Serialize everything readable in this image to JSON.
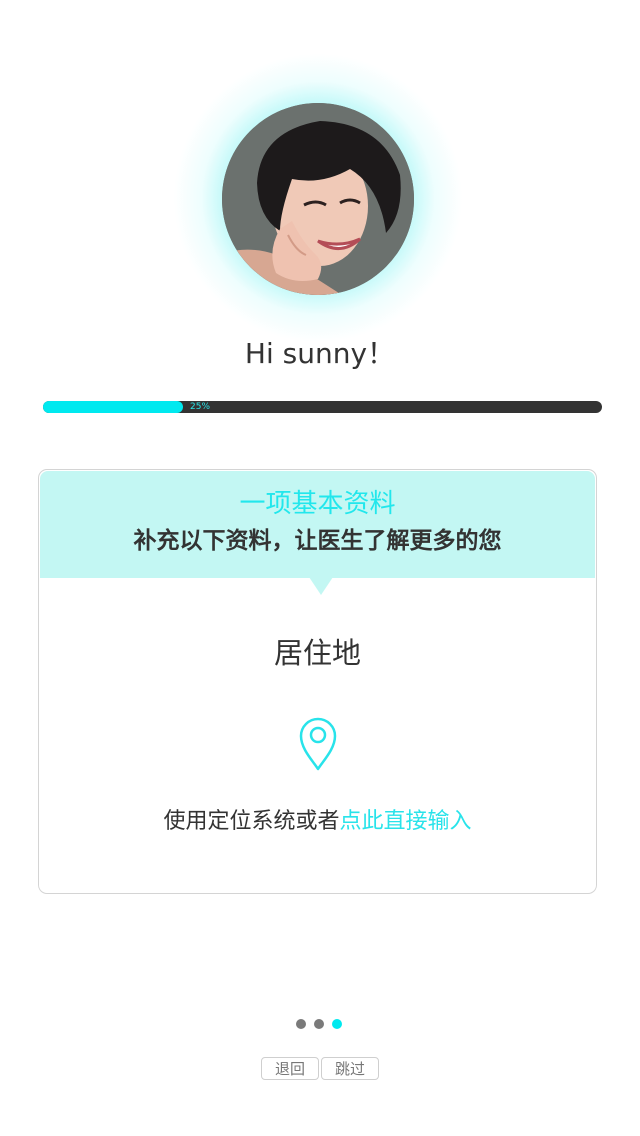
{
  "header": {
    "greeting": "Hi sunny！"
  },
  "progress": {
    "value": 0.25,
    "label": "25%"
  },
  "card": {
    "title": "一项基本资料",
    "subtitle": "补充以下资料，让医生了解更多的您",
    "field_title": "居住地",
    "location_icon": "map-pin-icon",
    "location_prompt": "使用定位系统或者",
    "location_link": "点此直接输入"
  },
  "pager": {
    "total": 3,
    "active": 3
  },
  "footer": {
    "back_label": "退回",
    "skip_label": "跳过"
  },
  "colors": {
    "accent": "#00e9ef",
    "dot_inactive": "#7a7a7a",
    "header_bg": "#c3f7f3",
    "text": "#333333"
  }
}
